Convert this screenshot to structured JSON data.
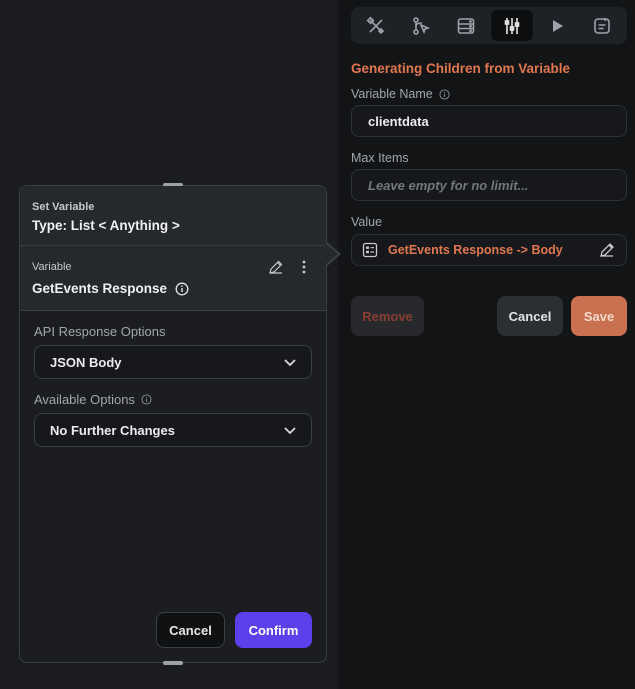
{
  "toolbar": {
    "tools": [
      {
        "icon": "tools-icon"
      },
      {
        "icon": "logic-branch-icon"
      },
      {
        "icon": "database-icon"
      },
      {
        "icon": "settings-sliders-icon",
        "active": true
      },
      {
        "icon": "play-icon"
      },
      {
        "icon": "notes-icon"
      }
    ]
  },
  "panel": {
    "title": "Generating Children from Variable",
    "variable_name_label": "Variable Name",
    "variable_name_value": "clientdata",
    "max_items_label": "Max Items",
    "max_items_placeholder": "Leave empty for no limit...",
    "value_label": "Value",
    "value_text": "GetEvents Response -> Body",
    "remove_label": "Remove",
    "cancel_label": "Cancel",
    "save_label": "Save"
  },
  "card": {
    "header_small": "Set Variable",
    "header_type": "Type: List < Anything >",
    "variable_small": "Variable",
    "variable_name": "GetEvents Response",
    "api_response_label": "API Response Options",
    "api_response_value": "JSON Body",
    "available_options_label": "Available Options",
    "available_options_value": "No Further Changes",
    "cancel_label": "Cancel",
    "confirm_label": "Confirm"
  },
  "colors": {
    "accent_orange": "#e0784f",
    "confirm_purple": "#5b40ec",
    "save_orange": "#c8704f",
    "remove_red": "#8a3d33"
  }
}
